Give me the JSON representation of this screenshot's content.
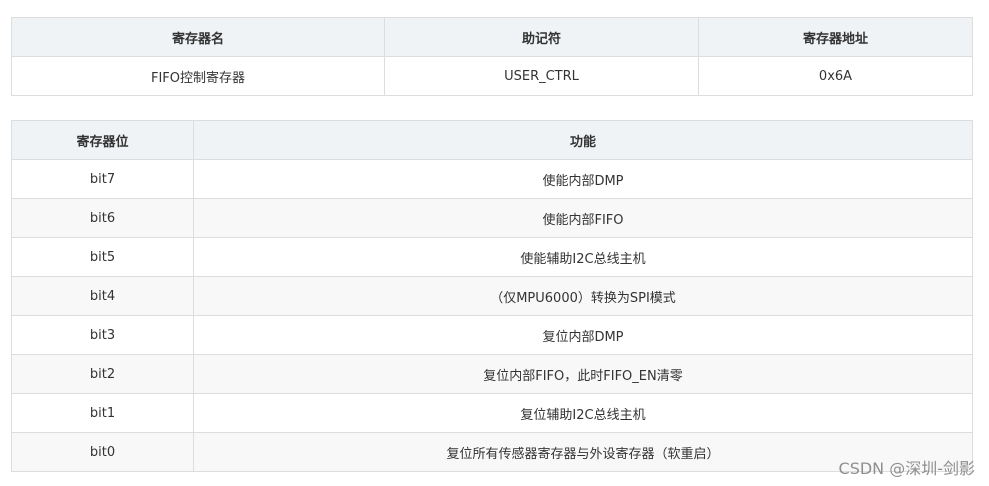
{
  "register_table": {
    "headers": [
      "寄存器名",
      "助记符",
      "寄存器地址"
    ],
    "row": [
      "FIFO控制寄存器",
      "USER_CTRL",
      "0x6A"
    ]
  },
  "bits_table": {
    "headers": [
      "寄存器位",
      "功能"
    ],
    "rows": [
      [
        "bit7",
        "使能内部DMP"
      ],
      [
        "bit6",
        "使能内部FIFO"
      ],
      [
        "bit5",
        "使能辅助I2C总线主机"
      ],
      [
        "bit4",
        "（仅MPU6000）转换为SPI模式"
      ],
      [
        "bit3",
        "复位内部DMP"
      ],
      [
        "bit2",
        "复位内部FIFO，此时FIFO_EN清零"
      ],
      [
        "bit1",
        "复位辅助I2C总线主机"
      ],
      [
        "bit0",
        "复位所有传感器寄存器与外设寄存器（软重启）"
      ]
    ]
  },
  "watermark": "CSDN @深圳-剑影"
}
